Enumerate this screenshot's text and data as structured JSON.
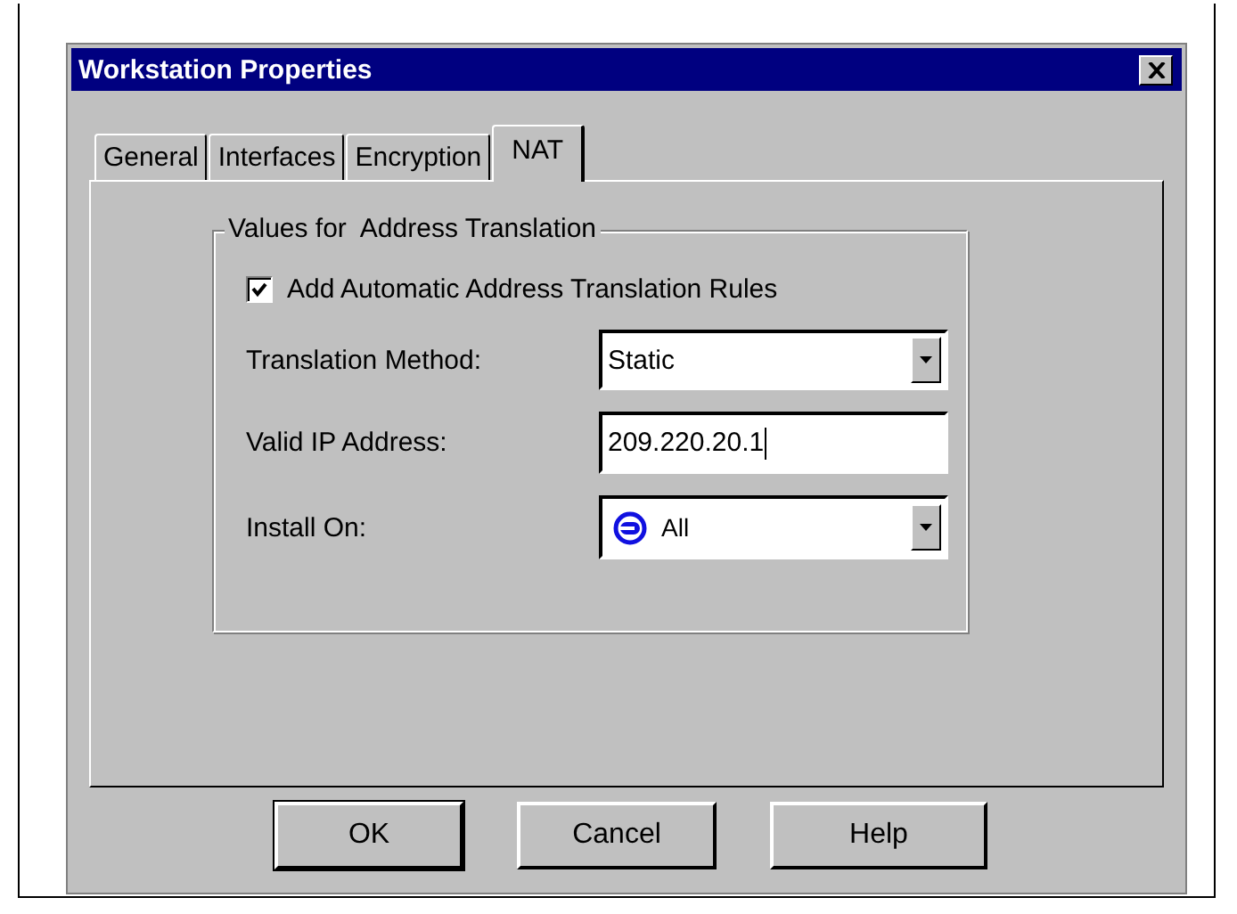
{
  "window": {
    "title": "Workstation Properties"
  },
  "tabs": [
    {
      "label": "General",
      "selected": false
    },
    {
      "label": "Interfaces",
      "selected": false
    },
    {
      "label": "Encryption",
      "selected": false
    },
    {
      "label": "NAT",
      "selected": true
    }
  ],
  "group": {
    "title": "Values for  Address Translation",
    "checkbox": {
      "label": "Add Automatic Address Translation Rules",
      "checked": true
    },
    "fields": [
      {
        "kind": "dropdown",
        "label": "Translation Method:",
        "value": "Static"
      },
      {
        "kind": "text",
        "label": "Valid IP Address:",
        "value": "209.220.20.1"
      },
      {
        "kind": "object-dropdown",
        "label": "Install On:",
        "value": "All"
      }
    ]
  },
  "buttons": [
    {
      "label": "OK",
      "default": true
    },
    {
      "label": "Cancel",
      "default": false
    },
    {
      "label": "Help",
      "default": false
    }
  ]
}
